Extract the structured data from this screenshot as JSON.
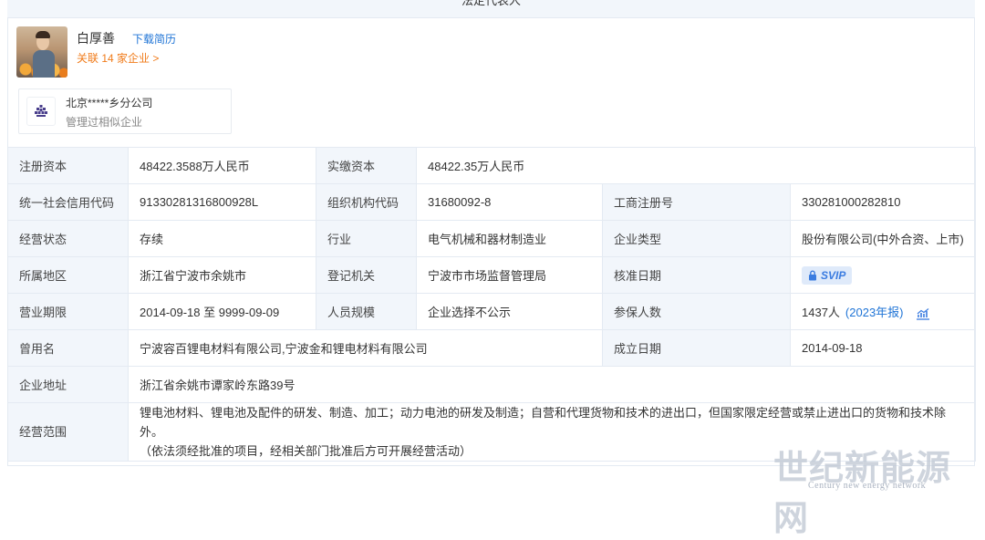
{
  "legal_rep_header": "法定代表人",
  "rep": {
    "name": "白厚善",
    "resume_link": "下载简历",
    "related_link": "关联 14 家企业 >"
  },
  "similar": {
    "title": "北京*****乡分公司",
    "subtitle": "管理过相似企业"
  },
  "info": {
    "reg_capital_label": "注册资本",
    "reg_capital_value": "48422.3588万人民币",
    "paid_capital_label": "实缴资本",
    "paid_capital_value": "48422.35万人民币",
    "credit_code_label": "统一社会信用代码",
    "credit_code_value": "91330281316800928L",
    "org_code_label": "组织机构代码",
    "org_code_value": "31680092-8",
    "biz_reg_label": "工商注册号",
    "biz_reg_value": "330281000282810",
    "status_label": "经营状态",
    "status_value": "存续",
    "industry_label": "行业",
    "industry_value": "电气机械和器材制造业",
    "type_label": "企业类型",
    "type_value": "股份有限公司(中外合资、上市)",
    "region_label": "所属地区",
    "region_value": "浙江省宁波市余姚市",
    "authority_label": "登记机关",
    "authority_value": "宁波市市场监督管理局",
    "approval_label": "核准日期",
    "approval_vip": "SVIP",
    "term_label": "营业期限",
    "term_value": "2014-09-18 至 9999-09-09",
    "staff_label": "人员规模",
    "staff_value": "企业选择不公示",
    "insured_label": "参保人数",
    "insured_value": "1437人",
    "insured_report": "(2023年报)",
    "former_label": "曾用名",
    "former_value": "宁波容百锂电材料有限公司,宁波金和锂电材料有限公司",
    "established_label": "成立日期",
    "established_value": "2014-09-18",
    "address_label": "企业地址",
    "address_value": "浙江省余姚市谭家岭东路39号",
    "scope_label": "经营范围",
    "scope_line1": "锂电池材料、锂电池及配件的研发、制造、加工；动力电池的研发及制造；自营和代理货物和技术的进出口，但国家限定经营或禁止进出口的货物和技术除外。",
    "scope_line2": "（依法须经批准的项目，经相关部门批准后方可开展经营活动）"
  },
  "watermark": {
    "cn": "世纪新能源网",
    "en": "Century new energy network"
  },
  "colors": {
    "link_blue": "#1f74d6",
    "link_orange": "#f07b1a",
    "label_bg": "#f2f6fb",
    "border": "#e4eaf2"
  }
}
